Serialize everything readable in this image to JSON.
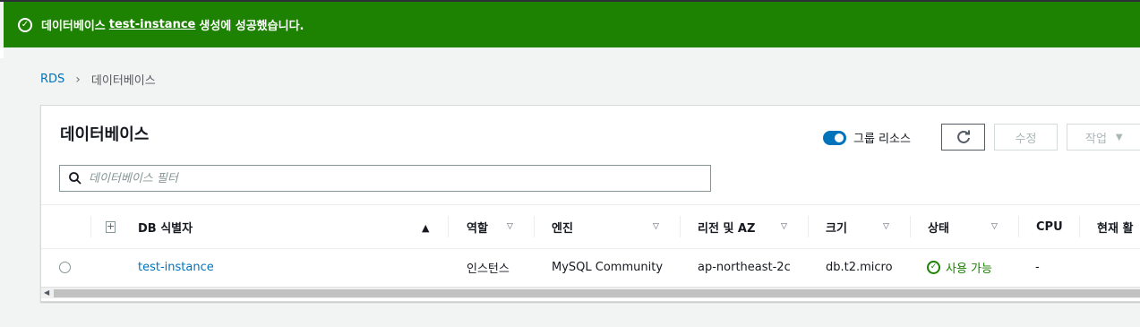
{
  "flash": {
    "prefix": "데이터베이스",
    "instance": "test-instance",
    "suffix": "생성에 성공했습니다.",
    "color": "#1d8102"
  },
  "breadcrumb": {
    "root": "RDS",
    "current": "데이터베이스"
  },
  "panel": {
    "title": "데이터베이스",
    "group_toggle_label": "그룹 리소스",
    "edit_label": "수정",
    "action_label": "작업",
    "search_placeholder": "데이터베이스 필터"
  },
  "columns": [
    {
      "label": "DB 식별자"
    },
    {
      "label": "역할"
    },
    {
      "label": "엔진"
    },
    {
      "label": "리전 및 AZ"
    },
    {
      "label": "크기"
    },
    {
      "label": "상태"
    },
    {
      "label": "CPU"
    },
    {
      "label": "현재 활"
    }
  ],
  "rows": [
    {
      "id": "test-instance",
      "role": "인스턴스",
      "engine": "MySQL Community",
      "az": "ap-northeast-2c",
      "size": "db.t2.micro",
      "status": "사용 가능",
      "cpu": "-"
    }
  ],
  "colors": {
    "accent": "#0073bb",
    "success": "#1d8102"
  }
}
